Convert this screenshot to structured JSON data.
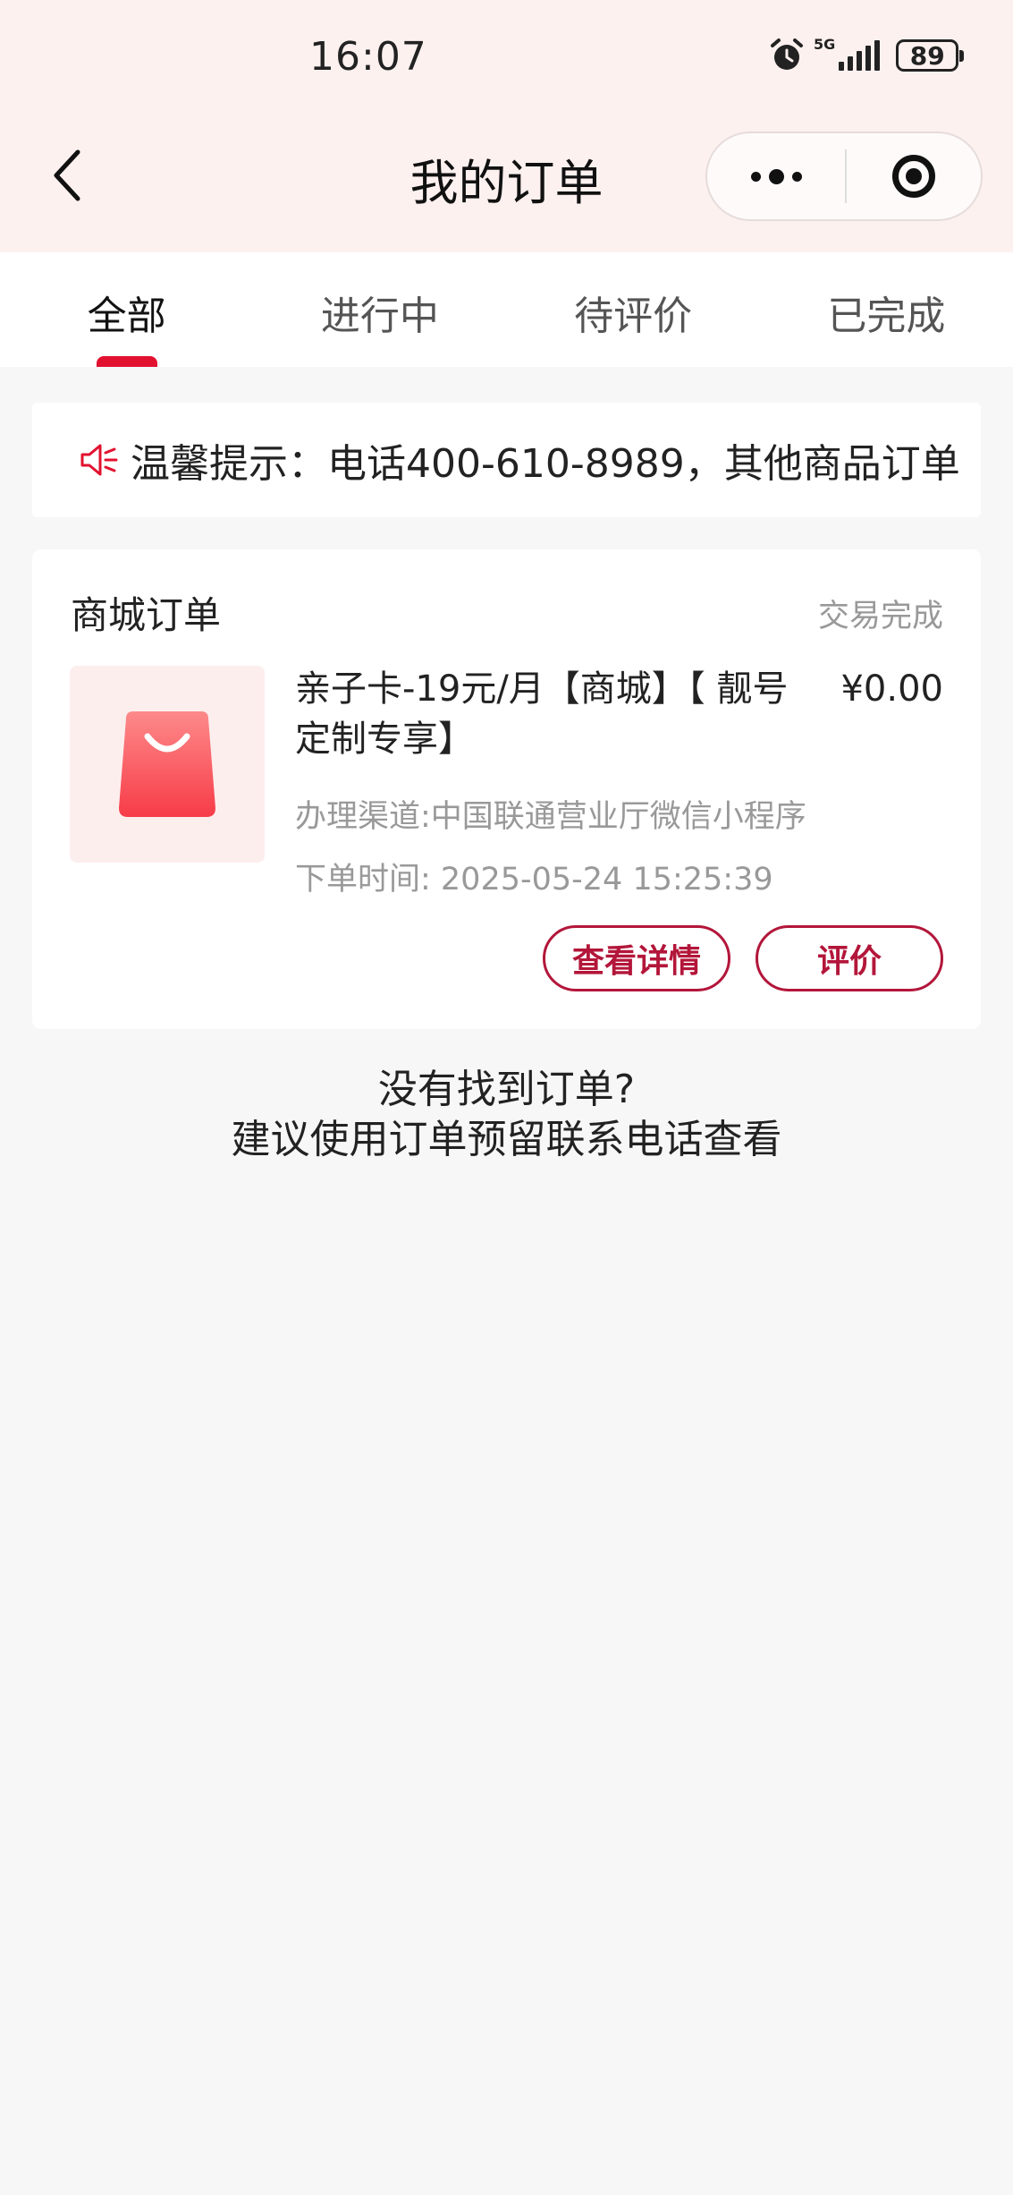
{
  "status_bar": {
    "time": "16:07",
    "network": "5G",
    "battery": "89",
    "icons": [
      "alarm-icon",
      "signal-icon",
      "battery-icon"
    ]
  },
  "nav": {
    "title": "我的订单",
    "back_icon": "back-chevron-icon",
    "more_icon": "more-dots-icon",
    "close_icon": "target-close-icon"
  },
  "tabs": [
    {
      "label": "全部",
      "active": true
    },
    {
      "label": "进行中",
      "active": false
    },
    {
      "label": "待评价",
      "active": false
    },
    {
      "label": "已完成",
      "active": false
    }
  ],
  "notice": {
    "icon": "speaker-icon",
    "text": "温馨提示：电话400-610-8989，其他商品订单"
  },
  "order": {
    "section_title": "商城订单",
    "status": "交易完成",
    "product_icon": "shopping-bag-icon",
    "product_name": "亲子卡-19元/月【商城】【 靓号定制专享】",
    "price": "¥0.00",
    "channel": "办理渠道:中国联通营业厅微信小程序",
    "order_time": "下单时间: 2025-05-24 15:25:39",
    "detail_button": "查看详情",
    "review_button": "评价"
  },
  "empty_hint": {
    "line1": "没有找到订单?",
    "line2": "建议使用订单预留联系电话查看"
  },
  "colors": {
    "accent": "#e2112f",
    "button_border": "#b3163a",
    "header_bg": "#fdf1ef",
    "page_bg": "#f7f7f7"
  }
}
